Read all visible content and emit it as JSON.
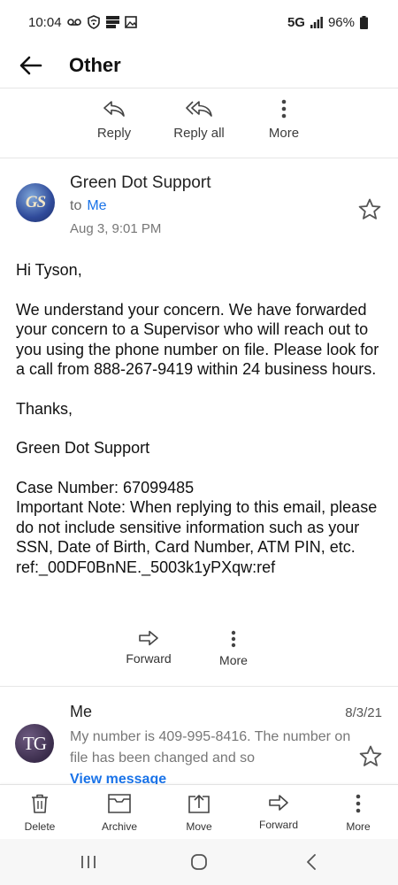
{
  "status_bar": {
    "time": "10:04",
    "network": "5G",
    "battery": "96%"
  },
  "topbar": {
    "title": "Other"
  },
  "actions": {
    "reply": "Reply",
    "reply_all": "Reply all",
    "more": "More"
  },
  "message": {
    "avatar_initials": "GS",
    "sender": "Green Dot Support",
    "to_prefix": "to",
    "to_name": "Me",
    "date": "Aug 3, 9:01 PM",
    "greeting": "Hi Tyson,",
    "paragraph1": "We understand your concern. We have forwarded your concern to a Supervisor who will reach out to you using the phone number on file. Please look for a call from 888-267-9419 within 24 business hours.",
    "thanks": "Thanks,",
    "signature": "Green Dot Support",
    "case_number": "Case Number: 67099485",
    "important_note": "Important Note: When replying to this email, please do not include sensitive information such as your SSN, Date of Birth, Card Number, ATM PIN, etc.",
    "ref": "ref:_00DF0BnNE._5003k1yPXqw:ref"
  },
  "message_actions": {
    "forward": "Forward",
    "more": "More"
  },
  "message2": {
    "avatar_initials": "TG",
    "sender": "Me",
    "date": "8/3/21",
    "snippet": "My number is 409-995-8416. The number on file has been changed and so",
    "view_message": "View message"
  },
  "bottom_toolbar": {
    "delete": "Delete",
    "archive": "Archive",
    "move": "Move",
    "forward": "Forward",
    "more": "More"
  },
  "colors": {
    "accent": "#1a73e8",
    "avatar_gs_bg": "#2f4a9a",
    "avatar_tg_bg": "#4a3b5e"
  }
}
